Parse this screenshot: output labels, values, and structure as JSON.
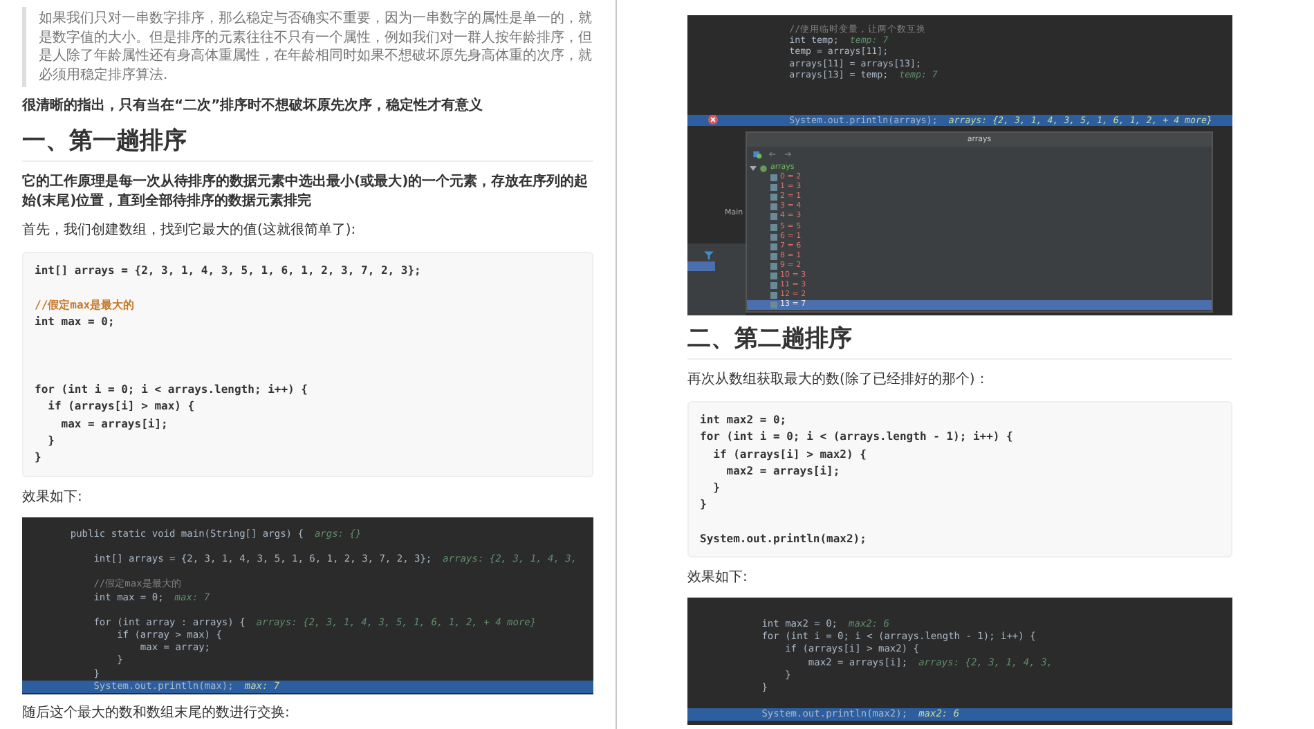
{
  "left_page": {
    "blocks": [
      {
        "kind": "quote",
        "text": "如果我们只对一串数字排序，那么稳定与否确实不重要，因为一串数字的属性是单一的，就是数字值的大小。但是排序的元素往往不只有一个属性，例如我们对一群人按年龄排序，但是人除了年龄属性还有身高体重属性，在年龄相同时如果不想破坏原先身高体重的次序，就必须用稳定排序算法."
      },
      {
        "kind": "paragraph",
        "bold": true,
        "text": "很清晰的指出，只有当在“二次”排序时不想破坏原先次序，稳定性才有意义"
      },
      {
        "kind": "heading",
        "text": "一、第一趟排序"
      },
      {
        "kind": "paragraph",
        "bold": true,
        "text": "它的工作原理是每一次从待排序的数据元素中选出最小(或最大)的一个元素，存放在序列的起始(末尾)位置，直到全部待排序的数据元素排完"
      },
      {
        "kind": "paragraph",
        "bold": false,
        "text": "首先，我们创建数组，找到它最大的值(这就很简单了):"
      },
      {
        "kind": "code",
        "lines": [
          {
            "kind": "code",
            "text": "int[] arrays = {2, 3, 1, 4, 3, 5, 1, 6, 1, 2, 3, 7, 2, 3};"
          },
          {
            "kind": "blank"
          },
          {
            "kind": "comment",
            "text": "//假定max是最大的"
          },
          {
            "kind": "code",
            "text": "int max = 0;"
          },
          {
            "kind": "blank"
          },
          {
            "kind": "blank"
          },
          {
            "kind": "blank"
          },
          {
            "kind": "code",
            "text": "for (int i = 0; i < arrays.length; i++) {"
          },
          {
            "kind": "code",
            "text": "  if (arrays[i] > max) {"
          },
          {
            "kind": "code",
            "text": "    max = arrays[i];"
          },
          {
            "kind": "code",
            "text": "  }"
          },
          {
            "kind": "code",
            "text": "}"
          }
        ]
      },
      {
        "kind": "paragraph",
        "bold": false,
        "text": "效果如下:"
      },
      {
        "kind": "ide",
        "lines": [
          {
            "kind": "code",
            "text": "    public static void main(String[] args) {",
            "hint": "args: {}",
            "highlighted": false
          },
          {
            "kind": "blank",
            "highlighted": false
          },
          {
            "kind": "code",
            "text": "        int[] arrays = {2, 3, 1, 4, 3, 5, 1, 6, 1, 2, 3, 7, 2, 3};",
            "hint": "arrays: {2, 3, 1, 4, 3,",
            "highlighted": false
          },
          {
            "kind": "blank",
            "highlighted": false
          },
          {
            "kind": "comment",
            "text": "        //假定max是最大的",
            "highlighted": false
          },
          {
            "kind": "code",
            "text": "        int max = 0;",
            "hint": "max: 7",
            "highlighted": false
          },
          {
            "kind": "blank",
            "highlighted": false
          },
          {
            "kind": "code",
            "text": "        for (int array : arrays) {",
            "hint": "arrays: {2, 3, 1, 4, 3, 5, 1, 6, 1, 2, + 4 more}",
            "highlighted": false
          },
          {
            "kind": "code",
            "text": "            if (array > max) {",
            "highlighted": false
          },
          {
            "kind": "code",
            "text": "                max = array;",
            "highlighted": false
          },
          {
            "kind": "code",
            "text": "            }",
            "highlighted": false
          },
          {
            "kind": "code",
            "text": "        }",
            "highlighted": false
          },
          {
            "kind": "code",
            "text": "        System.out.println(max);",
            "hint": "max: 7",
            "highlighted": true
          }
        ]
      },
      {
        "kind": "paragraph",
        "bold": false,
        "text": "随后这个最大的数和数组末尾的数进行交换:"
      }
    ]
  },
  "right_page": {
    "blocks": [
      {
        "kind": "ide",
        "tab_label": "Main",
        "lines": [
          {
            "kind": "comment",
            "text": "            //使用临时变量，让两个数互换",
            "highlighted": false,
            "breakpoint": false
          },
          {
            "kind": "code",
            "text": "            int temp;",
            "hint": "temp: 7",
            "highlighted": false,
            "breakpoint": false
          },
          {
            "kind": "code",
            "text": "            temp = arrays[11];",
            "highlighted": false,
            "breakpoint": false
          },
          {
            "kind": "code",
            "text": "            arrays[11] = arrays[13];",
            "highlighted": false,
            "breakpoint": false
          },
          {
            "kind": "code",
            "text": "            arrays[13] = temp;",
            "hint": "temp: 7",
            "highlighted": false,
            "breakpoint": false
          },
          {
            "kind": "blank",
            "highlighted": false,
            "breakpoint": false
          },
          {
            "kind": "blank",
            "highlighted": false,
            "breakpoint": false
          },
          {
            "kind": "blank",
            "highlighted": false,
            "breakpoint": false
          },
          {
            "kind": "code",
            "text": "            System.out.println(arrays);",
            "hint": "arrays: {2, 3, 1, 4, 3, 5, 1, 6, 1, 2, + 4 more}",
            "highlighted": true,
            "breakpoint": true
          }
        ],
        "popup": {
          "title": "arrays",
          "root": {
            "label": "arrays",
            "expanded": true,
            "children": [
              {
                "label": "0 = 2",
                "selected": false
              },
              {
                "label": "1 = 3",
                "selected": false
              },
              {
                "label": "2 = 1",
                "selected": false
              },
              {
                "label": "3 = 4",
                "selected": false
              },
              {
                "label": "4 = 3",
                "selected": false
              },
              {
                "label": "5 = 5",
                "selected": false
              },
              {
                "label": "6 = 1",
                "selected": false
              },
              {
                "label": "7 = 6",
                "selected": false
              },
              {
                "label": "8 = 1",
                "selected": false
              },
              {
                "label": "9 = 2",
                "selected": false
              },
              {
                "label": "10 = 3",
                "selected": false
              },
              {
                "label": "11 = 3",
                "selected": false
              },
              {
                "label": "12 = 2",
                "selected": false
              },
              {
                "label": "13 = 7",
                "selected": true
              }
            ]
          }
        }
      },
      {
        "kind": "heading",
        "text": "二、第二趟排序"
      },
      {
        "kind": "paragraph",
        "bold": false,
        "text": "再次从数组获取最大的数(除了已经排好的那个)："
      },
      {
        "kind": "code",
        "lines": [
          {
            "kind": "code",
            "text": "int max2 = 0;"
          },
          {
            "kind": "code",
            "text": "for (int i = 0; i < (arrays.length - 1); i++) {"
          },
          {
            "kind": "code",
            "text": "  if (arrays[i] > max2) {"
          },
          {
            "kind": "code",
            "text": "    max2 = arrays[i];"
          },
          {
            "kind": "code",
            "text": "  }"
          },
          {
            "kind": "code",
            "text": "}"
          },
          {
            "kind": "blank"
          },
          {
            "kind": "code",
            "text": "System.out.println(max2);"
          }
        ]
      },
      {
        "kind": "paragraph",
        "bold": false,
        "text": "效果如下:"
      },
      {
        "kind": "ide",
        "lines": [
          {
            "kind": "blank",
            "highlighted": false
          },
          {
            "kind": "code",
            "text": "        int max2 = 0;",
            "hint": "max2: 6",
            "highlighted": false
          },
          {
            "kind": "code",
            "text": "        for (int i = 0; i < (arrays.length - 1); i++) {",
            "highlighted": false
          },
          {
            "kind": "code",
            "text": "            if (arrays[i] > max2) {",
            "highlighted": false
          },
          {
            "kind": "code",
            "text": "                max2 = arrays[i];",
            "hint": "arrays: {2, 3, 1, 4, 3,",
            "highlighted": false
          },
          {
            "kind": "code",
            "text": "            }",
            "highlighted": false
          },
          {
            "kind": "code",
            "text": "        }",
            "highlighted": false
          },
          {
            "kind": "blank",
            "highlighted": false
          },
          {
            "kind": "code",
            "text": "        System.out.println(max2);",
            "hint": "max2: 6",
            "highlighted": true
          }
        ]
      }
    ]
  }
}
